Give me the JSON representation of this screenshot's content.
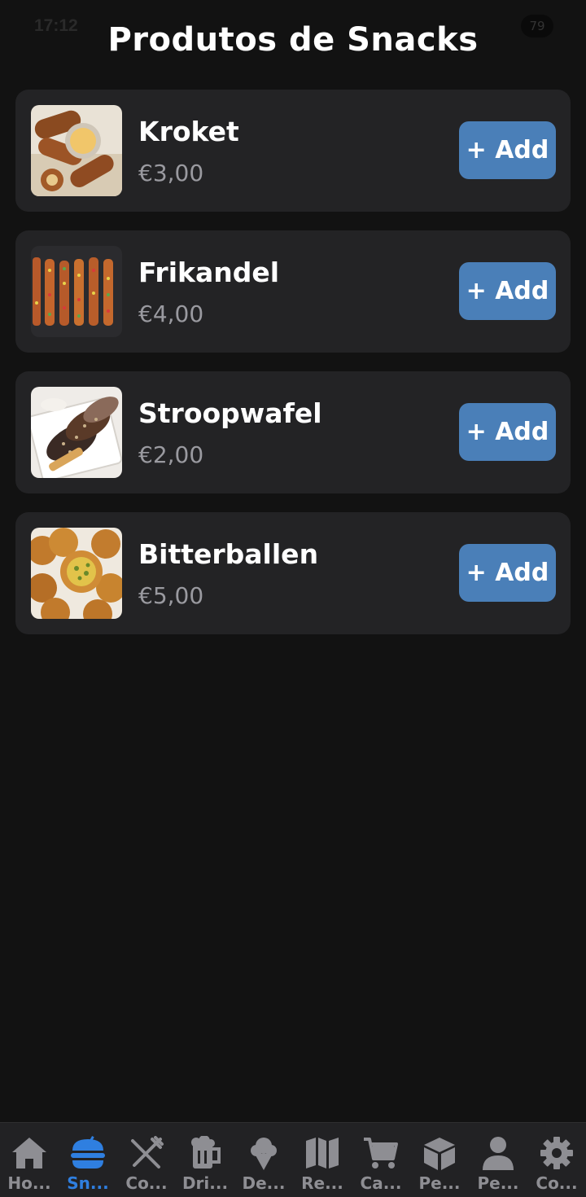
{
  "status_bar": {
    "time": "17:12",
    "battery": "79"
  },
  "page": {
    "title": "Produtos de Snacks"
  },
  "products": [
    {
      "name": "Kroket",
      "price": "€3,00",
      "add_label": "+ Add",
      "image": "kroket-photo"
    },
    {
      "name": "Frikandel",
      "price": "€4,00",
      "add_label": "+ Add",
      "image": "frikandel-photo"
    },
    {
      "name": "Stroopwafel",
      "price": "€2,00",
      "add_label": "+ Add",
      "image": "stroopwafel-photo"
    },
    {
      "name": "Bitterballen",
      "price": "€5,00",
      "add_label": "+ Add",
      "image": "bitterballen-photo"
    }
  ],
  "bottom_nav": {
    "active_index": 1,
    "active_color": "#2f7fe0",
    "inactive_color": "#8e8e93",
    "items": [
      {
        "label": "Ho...",
        "icon": "home-icon"
      },
      {
        "label": "Sn...",
        "icon": "burger-icon"
      },
      {
        "label": "Co...",
        "icon": "utensils-icon"
      },
      {
        "label": "Dri...",
        "icon": "beer-mug-icon"
      },
      {
        "label": "De...",
        "icon": "ice-cream-icon"
      },
      {
        "label": "Re...",
        "icon": "map-icon"
      },
      {
        "label": "Ca...",
        "icon": "cart-icon"
      },
      {
        "label": "Pe...",
        "icon": "box-icon"
      },
      {
        "label": "Pe...",
        "icon": "user-icon"
      },
      {
        "label": "Co...",
        "icon": "gear-icon"
      }
    ]
  }
}
